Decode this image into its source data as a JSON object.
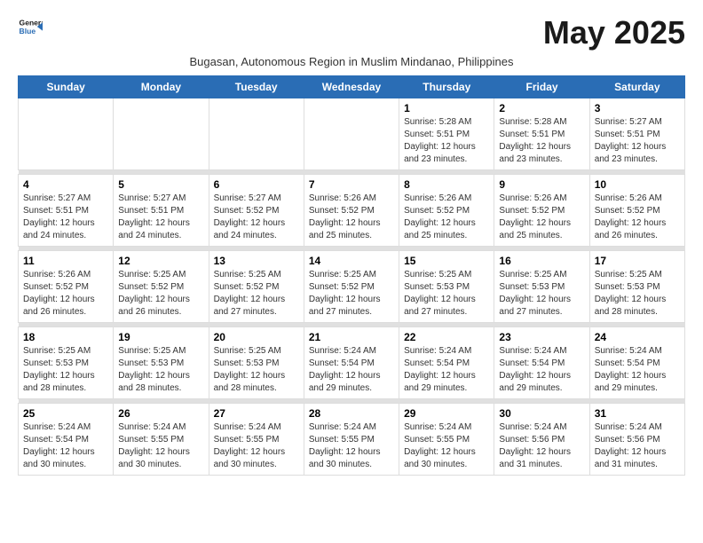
{
  "header": {
    "logo_line1": "General",
    "logo_line2": "Blue",
    "month": "May 2025",
    "subtitle": "Bugasan, Autonomous Region in Muslim Mindanao, Philippines"
  },
  "days_of_week": [
    "Sunday",
    "Monday",
    "Tuesday",
    "Wednesday",
    "Thursday",
    "Friday",
    "Saturday"
  ],
  "weeks": [
    [
      {
        "day": "",
        "info": ""
      },
      {
        "day": "",
        "info": ""
      },
      {
        "day": "",
        "info": ""
      },
      {
        "day": "",
        "info": ""
      },
      {
        "day": "1",
        "info": "Sunrise: 5:28 AM\nSunset: 5:51 PM\nDaylight: 12 hours\nand 23 minutes."
      },
      {
        "day": "2",
        "info": "Sunrise: 5:28 AM\nSunset: 5:51 PM\nDaylight: 12 hours\nand 23 minutes."
      },
      {
        "day": "3",
        "info": "Sunrise: 5:27 AM\nSunset: 5:51 PM\nDaylight: 12 hours\nand 23 minutes."
      }
    ],
    [
      {
        "day": "4",
        "info": "Sunrise: 5:27 AM\nSunset: 5:51 PM\nDaylight: 12 hours\nand 24 minutes."
      },
      {
        "day": "5",
        "info": "Sunrise: 5:27 AM\nSunset: 5:51 PM\nDaylight: 12 hours\nand 24 minutes."
      },
      {
        "day": "6",
        "info": "Sunrise: 5:27 AM\nSunset: 5:52 PM\nDaylight: 12 hours\nand 24 minutes."
      },
      {
        "day": "7",
        "info": "Sunrise: 5:26 AM\nSunset: 5:52 PM\nDaylight: 12 hours\nand 25 minutes."
      },
      {
        "day": "8",
        "info": "Sunrise: 5:26 AM\nSunset: 5:52 PM\nDaylight: 12 hours\nand 25 minutes."
      },
      {
        "day": "9",
        "info": "Sunrise: 5:26 AM\nSunset: 5:52 PM\nDaylight: 12 hours\nand 25 minutes."
      },
      {
        "day": "10",
        "info": "Sunrise: 5:26 AM\nSunset: 5:52 PM\nDaylight: 12 hours\nand 26 minutes."
      }
    ],
    [
      {
        "day": "11",
        "info": "Sunrise: 5:26 AM\nSunset: 5:52 PM\nDaylight: 12 hours\nand 26 minutes."
      },
      {
        "day": "12",
        "info": "Sunrise: 5:25 AM\nSunset: 5:52 PM\nDaylight: 12 hours\nand 26 minutes."
      },
      {
        "day": "13",
        "info": "Sunrise: 5:25 AM\nSunset: 5:52 PM\nDaylight: 12 hours\nand 27 minutes."
      },
      {
        "day": "14",
        "info": "Sunrise: 5:25 AM\nSunset: 5:52 PM\nDaylight: 12 hours\nand 27 minutes."
      },
      {
        "day": "15",
        "info": "Sunrise: 5:25 AM\nSunset: 5:53 PM\nDaylight: 12 hours\nand 27 minutes."
      },
      {
        "day": "16",
        "info": "Sunrise: 5:25 AM\nSunset: 5:53 PM\nDaylight: 12 hours\nand 27 minutes."
      },
      {
        "day": "17",
        "info": "Sunrise: 5:25 AM\nSunset: 5:53 PM\nDaylight: 12 hours\nand 28 minutes."
      }
    ],
    [
      {
        "day": "18",
        "info": "Sunrise: 5:25 AM\nSunset: 5:53 PM\nDaylight: 12 hours\nand 28 minutes."
      },
      {
        "day": "19",
        "info": "Sunrise: 5:25 AM\nSunset: 5:53 PM\nDaylight: 12 hours\nand 28 minutes."
      },
      {
        "day": "20",
        "info": "Sunrise: 5:25 AM\nSunset: 5:53 PM\nDaylight: 12 hours\nand 28 minutes."
      },
      {
        "day": "21",
        "info": "Sunrise: 5:24 AM\nSunset: 5:54 PM\nDaylight: 12 hours\nand 29 minutes."
      },
      {
        "day": "22",
        "info": "Sunrise: 5:24 AM\nSunset: 5:54 PM\nDaylight: 12 hours\nand 29 minutes."
      },
      {
        "day": "23",
        "info": "Sunrise: 5:24 AM\nSunset: 5:54 PM\nDaylight: 12 hours\nand 29 minutes."
      },
      {
        "day": "24",
        "info": "Sunrise: 5:24 AM\nSunset: 5:54 PM\nDaylight: 12 hours\nand 29 minutes."
      }
    ],
    [
      {
        "day": "25",
        "info": "Sunrise: 5:24 AM\nSunset: 5:54 PM\nDaylight: 12 hours\nand 30 minutes."
      },
      {
        "day": "26",
        "info": "Sunrise: 5:24 AM\nSunset: 5:55 PM\nDaylight: 12 hours\nand 30 minutes."
      },
      {
        "day": "27",
        "info": "Sunrise: 5:24 AM\nSunset: 5:55 PM\nDaylight: 12 hours\nand 30 minutes."
      },
      {
        "day": "28",
        "info": "Sunrise: 5:24 AM\nSunset: 5:55 PM\nDaylight: 12 hours\nand 30 minutes."
      },
      {
        "day": "29",
        "info": "Sunrise: 5:24 AM\nSunset: 5:55 PM\nDaylight: 12 hours\nand 30 minutes."
      },
      {
        "day": "30",
        "info": "Sunrise: 5:24 AM\nSunset: 5:56 PM\nDaylight: 12 hours\nand 31 minutes."
      },
      {
        "day": "31",
        "info": "Sunrise: 5:24 AM\nSunset: 5:56 PM\nDaylight: 12 hours\nand 31 minutes."
      }
    ]
  ]
}
